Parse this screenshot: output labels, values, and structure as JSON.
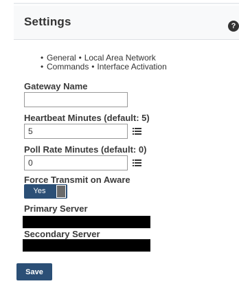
{
  "header": {
    "title": "Settings",
    "help_glyph": "?",
    "help_icon": "question-circle-icon"
  },
  "nav": {
    "rows": [
      [
        "General",
        "Local Area Network"
      ],
      [
        "Commands",
        "Interface Activation"
      ]
    ]
  },
  "form": {
    "gateway_name": {
      "label": "Gateway Name",
      "value": ""
    },
    "heartbeat_minutes": {
      "label": "Heartbeat Minutes (default: 5)",
      "value": "5"
    },
    "poll_rate_minutes": {
      "label": "Poll Rate Minutes (default: 0)",
      "value": "0"
    },
    "force_transmit": {
      "label": "Force Transmit on Aware",
      "state_label": "Yes"
    },
    "primary_server": {
      "label": "Primary Server"
    },
    "secondary_server": {
      "label": "Secondary Server"
    }
  },
  "actions": {
    "save_label": "Save"
  },
  "colors": {
    "accent": "#2b4f76",
    "header_bg": "#f8f9fa",
    "redaction": "#000000"
  }
}
